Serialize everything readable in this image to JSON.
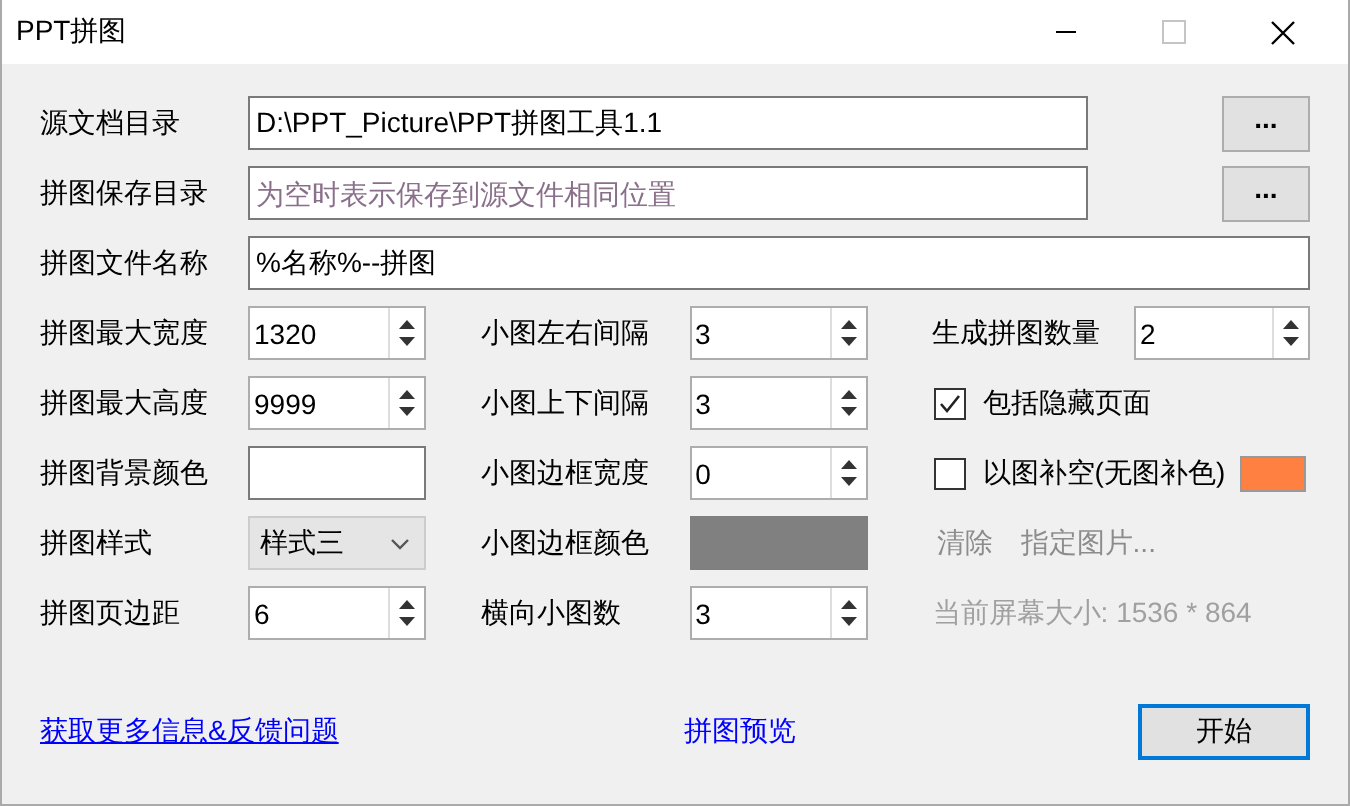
{
  "window": {
    "title": "PPT拼图"
  },
  "path_rows": [
    {
      "label": "源文档目录",
      "value": "D:\\PPT_Picture\\PPT拼图工具1.1",
      "button": "..."
    },
    {
      "label": "拼图保存目录",
      "placeholder": "为空时表示保存到源文件相同位置",
      "button": "..."
    },
    {
      "label": "拼图文件名称",
      "value": "%名称%--拼图"
    }
  ],
  "grid": [
    [
      {
        "kind": "spinner",
        "label": "拼图最大宽度",
        "value": "1320"
      },
      {
        "kind": "spinner",
        "label": "小图左右间隔",
        "value": "3"
      },
      {
        "kind": "spinner",
        "label": "生成拼图数量",
        "value": "2"
      }
    ],
    [
      {
        "kind": "spinner",
        "label": "拼图最大高度",
        "value": "9999"
      },
      {
        "kind": "spinner",
        "label": "小图上下间隔",
        "value": "3"
      },
      {
        "kind": "checkbox",
        "label": "包括隐藏页面",
        "checked": true
      }
    ],
    [
      {
        "kind": "color",
        "label": "拼图背景颜色",
        "color": "#ffffff"
      },
      {
        "kind": "spinner",
        "label": "小图边框宽度",
        "value": "0"
      },
      {
        "kind": "checkbox",
        "label": "以图补空(无图补色)",
        "checked": false,
        "color": "#ff8040"
      }
    ],
    [
      {
        "kind": "select",
        "label": "拼图样式",
        "value": "样式三"
      },
      {
        "kind": "color",
        "label": "小图边框颜色",
        "color": "#808080"
      },
      {
        "kind": "actions",
        "items": [
          {
            "label": "清除",
            "disabled": true
          },
          {
            "label": "指定图片...",
            "disabled": true
          }
        ]
      }
    ],
    [
      {
        "kind": "spinner",
        "label": "拼图页边距",
        "value": "6"
      },
      {
        "kind": "spinner",
        "label": "横向小图数",
        "value": "3"
      },
      {
        "kind": "info",
        "text": "当前屏幕大小: 1536 * 864"
      }
    ]
  ],
  "footer": {
    "link": "获取更多信息&反馈问题",
    "preview": "拼图预览",
    "start_button": "开始"
  }
}
